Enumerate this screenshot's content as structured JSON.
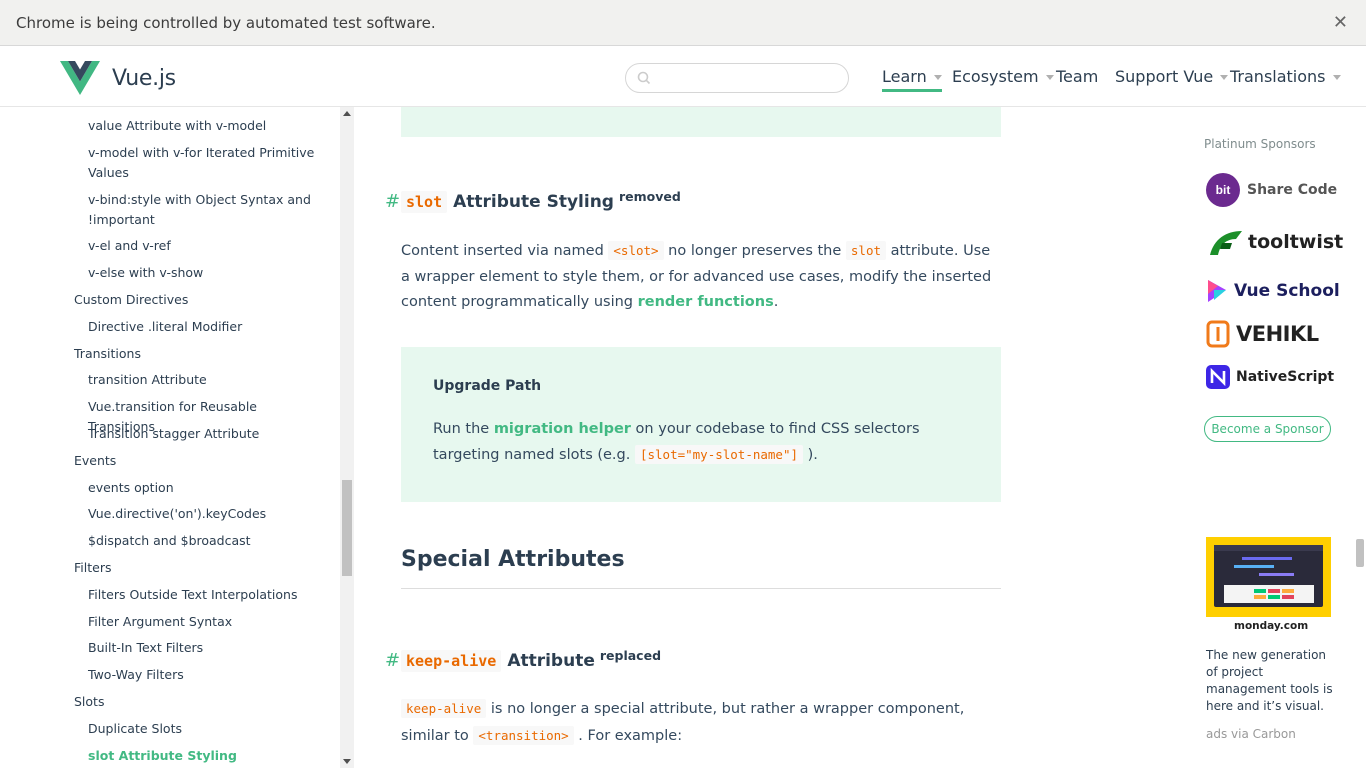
{
  "browser": {
    "infobar_text": "Chrome is being controlled by automated test software.",
    "close_glyph": "✕"
  },
  "header": {
    "logo_text": "Vue.js",
    "search_placeholder": "",
    "nav": [
      {
        "label": "Learn",
        "dropdown": true,
        "active": true
      },
      {
        "label": "Ecosystem",
        "dropdown": true
      },
      {
        "label": "Team",
        "dropdown": false
      },
      {
        "label": "Support Vue",
        "dropdown": true
      },
      {
        "label": "Translations",
        "dropdown": true
      }
    ],
    "accent_color": "#42b983"
  },
  "sidebar": {
    "items": [
      {
        "label": "value Attribute with v-model",
        "level": 2
      },
      {
        "label": "v-model with v-for Iterated Primitive Values",
        "level": 2
      },
      {
        "label": "v-bind:style with Object Syntax and !important",
        "level": 2
      },
      {
        "label": "v-el and v-ref",
        "level": 2
      },
      {
        "label": "v-else with v-show",
        "level": 2
      },
      {
        "label": "Custom Directives",
        "level": 1
      },
      {
        "label": "Directive .literal Modifier",
        "level": 2
      },
      {
        "label": "Transitions",
        "level": 1
      },
      {
        "label": "transition Attribute",
        "level": 2
      },
      {
        "label": "Vue.transition for Reusable Transitions",
        "level": 2
      },
      {
        "label": "Transition stagger Attribute",
        "level": 2
      },
      {
        "label": "Events",
        "level": 1
      },
      {
        "label": "events option",
        "level": 2
      },
      {
        "label": "Vue.directive('on').keyCodes",
        "level": 2
      },
      {
        "label": "$dispatch and $broadcast",
        "level": 2
      },
      {
        "label": "Filters",
        "level": 1
      },
      {
        "label": "Filters Outside Text Interpolations",
        "level": 2
      },
      {
        "label": "Filter Argument Syntax",
        "level": 2
      },
      {
        "label": "Built-In Text Filters",
        "level": 2
      },
      {
        "label": "Two-Way Filters",
        "level": 2
      },
      {
        "label": "Slots",
        "level": 1
      },
      {
        "label": "Duplicate Slots",
        "level": 2
      },
      {
        "label": "slot Attribute Styling",
        "level": 2,
        "active": true
      }
    ]
  },
  "main": {
    "section1": {
      "hash": "#",
      "code": "slot",
      "title": "Attribute Styling",
      "badge": "removed",
      "para": {
        "t1": "Content inserted via named ",
        "c1": "<slot>",
        "t2": " no longer preserves the ",
        "c2": "slot",
        "t3": " attribute. Use a wrapper element to style them, or for advanced use cases, modify the inserted content programmatically using ",
        "link": "render functions",
        "t4": "."
      }
    },
    "tip": {
      "title": "Upgrade Path",
      "t1": "Run the ",
      "link": "migration helper",
      "t2": " on your codebase to find CSS selectors targeting named slots (e.g. ",
      "code": "[slot=\"my-slot-name\"]",
      "t3": " )."
    },
    "heading2": "Special Attributes",
    "section2": {
      "hash": "#",
      "code": "keep-alive",
      "title": "Attribute",
      "badge": "replaced",
      "para": {
        "c1": "keep-alive",
        "t1": " is no longer a special attribute, but rather a wrapper component, similar to ",
        "c2": "<transition>",
        "t2": " . For example:"
      }
    }
  },
  "sponsors": {
    "title": "Platinum Sponsors",
    "items": [
      {
        "name": "Share Code",
        "icon": "bit-icon"
      },
      {
        "name": "tooltwist",
        "icon": "tooltwist-icon"
      },
      {
        "name": "Vue School",
        "icon": "vueschool-icon"
      },
      {
        "name": "VEHIKL",
        "icon": "vehikl-icon"
      },
      {
        "name": "NativeScript",
        "icon": "nativescript-icon"
      }
    ],
    "become_label": "Become a Sponsor"
  },
  "ad": {
    "brand": "monday.com",
    "text": "The new generation of project management tools is here and it’s visual.",
    "via": "ads via Carbon"
  }
}
